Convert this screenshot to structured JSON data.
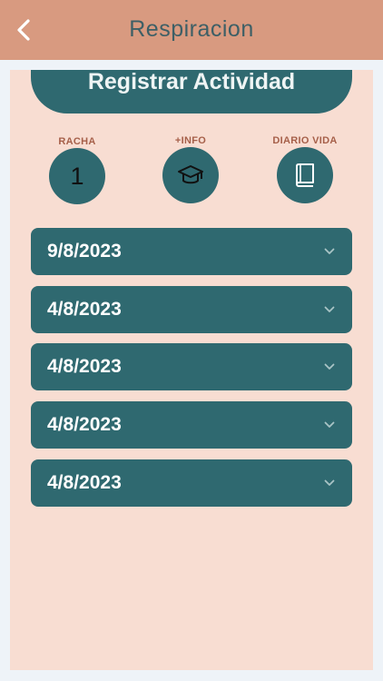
{
  "header": {
    "title": "Respiracion",
    "back_icon": "chevron-left-icon"
  },
  "register_button": {
    "label": "Registrar Actividad"
  },
  "stats": {
    "streak": {
      "label": "RACHA",
      "value": "1"
    },
    "info": {
      "label": "+INFO",
      "icon": "graduation-cap-icon"
    },
    "diary": {
      "label": "DIARIO VIDA",
      "icon": "book-icon"
    }
  },
  "entries": [
    {
      "date": "9/8/2023"
    },
    {
      "date": "4/8/2023"
    },
    {
      "date": "4/8/2023"
    },
    {
      "date": "4/8/2023"
    },
    {
      "date": "4/8/2023"
    }
  ],
  "colors": {
    "header_bg": "#d89a80",
    "panel_bg": "#f8ddd2",
    "accent": "#2f6970",
    "label": "#a6604a"
  }
}
